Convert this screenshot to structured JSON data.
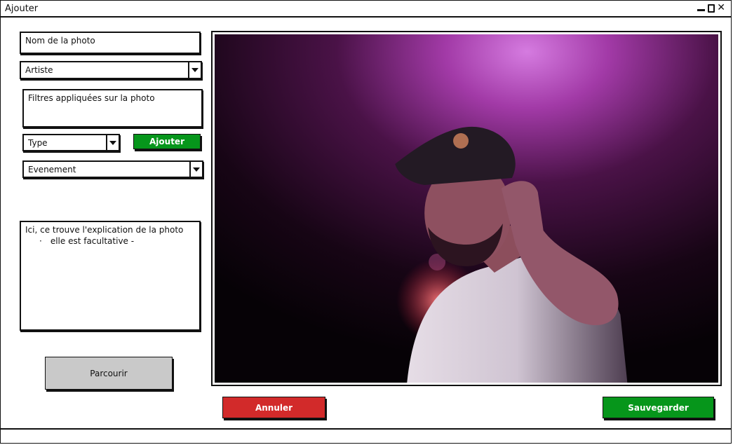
{
  "window": {
    "title": "Ajouter",
    "controls": {
      "minimize": "minimize-icon",
      "maximize": "maximize-icon",
      "close": "close-icon"
    }
  },
  "form": {
    "photo_name": {
      "placeholder": "Nom de la photo",
      "value": "Nom de la photo"
    },
    "artist_select": {
      "value": "Artiste"
    },
    "filters_text": {
      "value": "Filtres appliquées sur la photo"
    },
    "type_select": {
      "value": "Type"
    },
    "add_button": "Ajouter",
    "event_select": {
      "value": "Evenement"
    },
    "description": {
      "line1": "Ici, ce trouve l'explication de la photo",
      "bullet": "·",
      "line2": "elle est facultative -"
    },
    "browse_button": "Parcourir"
  },
  "photo": {
    "alt": "Photo d'un artiste sur scène sous une lumière violette"
  },
  "actions": {
    "cancel": "Annuler",
    "save": "Sauvegarder"
  },
  "colors": {
    "green": "#06961b",
    "red": "#d22a2a",
    "gray": "#c9c9c9"
  }
}
